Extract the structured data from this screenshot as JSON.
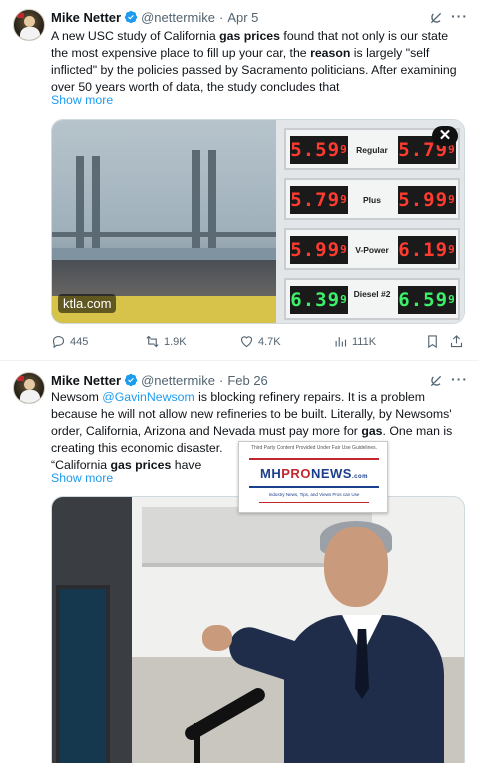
{
  "tweets": [
    {
      "name": "Mike Netter",
      "handle": "@nettermike",
      "date": "Apr 5",
      "text": {
        "line1_a": "A new USC study of California ",
        "line1_b": "gas prices",
        "line1_c": " found that not only is our state",
        "line2": "the most expensive place to fill up your car, the ",
        "line2_b": "reason",
        "line2_c": " is largely \"self",
        "line3": "inflicted\" by the policies passed by Sacramento politicians. After examining",
        "line4": "over 50 years worth of data, the study concludes that"
      },
      "show_more": "Show more",
      "media": {
        "watermark": "ktla.com",
        "close": "✕",
        "prices": [
          {
            "grade": "Regular",
            "left": "5.59",
            "left_frac": "9",
            "right": "5.79",
            "right_frac": "9",
            "color": "red"
          },
          {
            "grade": "Plus",
            "left": "5.79",
            "left_frac": "9",
            "right": "5.99",
            "right_frac": "9",
            "color": "red"
          },
          {
            "grade": "V-Power",
            "left": "5.99",
            "left_frac": "9",
            "right": "6.19",
            "right_frac": "9",
            "color": "red"
          },
          {
            "grade": "Diesel #2",
            "left": "6.39",
            "left_frac": "9",
            "right": "6.59",
            "right_frac": "9",
            "color": "green"
          }
        ]
      },
      "actions": {
        "replies": "445",
        "reposts": "1.9K",
        "likes": "4.7K",
        "views": "111K"
      },
      "icons": {
        "verified": "verified-badge-icon",
        "grok": "grok-icon",
        "more": "more-icon",
        "reply": "reply-icon",
        "repost": "repost-icon",
        "like": "heart-icon",
        "views": "views-icon",
        "bookmark": "bookmark-icon",
        "share": "share-icon"
      }
    },
    {
      "name": "Mike Netter",
      "handle": "@nettermike",
      "date": "Feb 26",
      "text": {
        "line1_a": "Newsom ",
        "line1_mention": "@GavinNewsom",
        "line1_b": " is blocking refinery repairs.  It is a problem",
        "line2": "because he will not allow new refineries to be built.  Literally, by Newsoms'",
        "line3_a": "order, California, Arizona and Nevada must pay more for ",
        "line3_b": "gas",
        "line3_c": ".  One man is",
        "line4": "creating this economic disaster.",
        "line5_a": "“California ",
        "line5_b": "gas prices",
        "line5_c": " have"
      },
      "show_more": "Show more"
    }
  ],
  "overlay": {
    "caption": "Third Party Content Provided Under Fair Use Guidelines.",
    "logo_a": "MH",
    "logo_b": "PRO",
    "logo_c": "NEWS",
    "logo_d": ".com",
    "tagline": "Industry News, Tips, and Views Pros can Use"
  },
  "colors": {
    "link": "#1d9bf0",
    "verified": "#1d9bf0",
    "text": "#0f1419",
    "secondary": "#536471",
    "price_red": "#ff3b30",
    "price_green": "#3cf06a"
  }
}
